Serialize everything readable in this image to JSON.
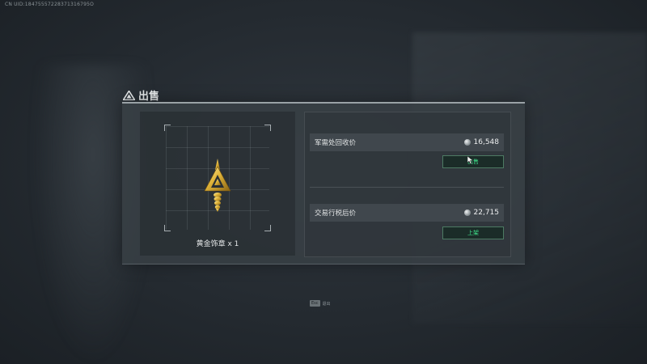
{
  "uid_text": "CN UID:18475557228371316795O",
  "title": "出售",
  "item": {
    "name": "黄金饰章 x 1",
    "icon": "golden-badge-icon"
  },
  "offers": [
    {
      "label": "军需处回收价",
      "price": "16,548",
      "button": "出售"
    },
    {
      "label": "交易行税后价",
      "price": "22,715",
      "button": "上架"
    }
  ],
  "footer": {
    "key": "Esc",
    "label": "退出"
  },
  "colors": {
    "accent_green": "#3fe08a",
    "button_border": "#4d7a63",
    "panel_bg": "#3a4146"
  }
}
